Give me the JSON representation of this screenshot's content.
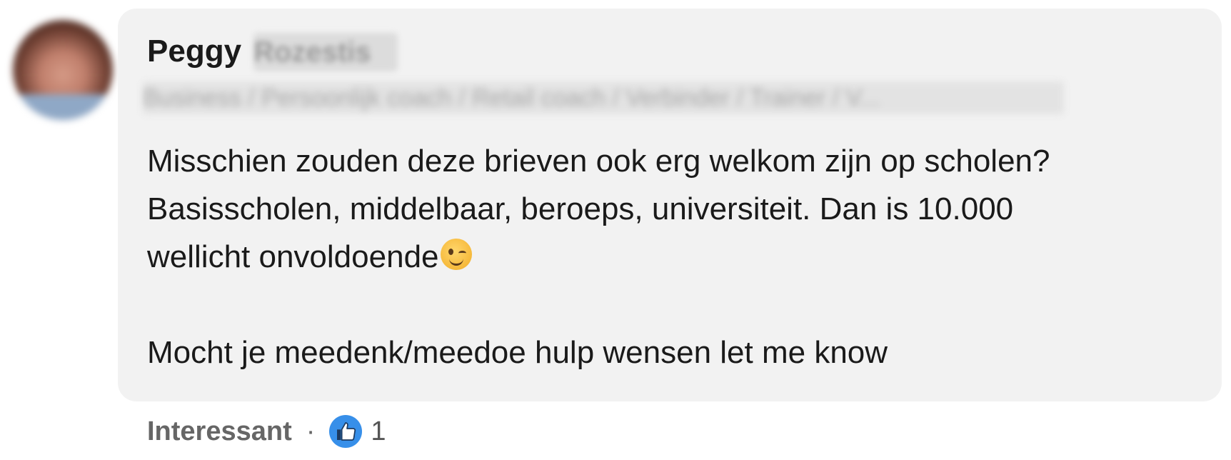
{
  "comment": {
    "author_first_name": "Peggy",
    "author_last_name_redacted": "Rozestis",
    "author_headline_redacted": "Business / Persoonlijk coach / Retail coach / Verbinder / Trainer / V...",
    "lines": [
      "Misschien zouden deze brieven ook erg welkom zijn op scholen?",
      "Basisscholen, middelbaar, beroeps, universiteit. Dan is 10.000",
      "wellicht onvoldoende",
      "Mocht je meedenk/meedoe hulp wensen let me know"
    ],
    "emoji": "winking-face"
  },
  "actions": {
    "reaction_label": "Interessant",
    "separator": "·",
    "reaction_icon": "thumbs-up-icon",
    "reaction_count": "1"
  },
  "colors": {
    "bubble_bg": "#f2f2f2",
    "like_blue": "#378fe9"
  }
}
